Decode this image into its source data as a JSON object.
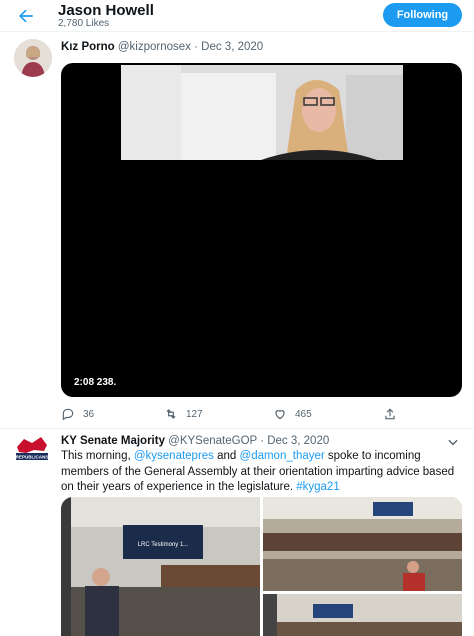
{
  "header": {
    "back_icon": "arrow-left-icon",
    "title": "Jason Howell",
    "subtitle": "2,780 Likes",
    "follow_label": "Following",
    "accent": "#1d9bf0"
  },
  "tweets": [
    {
      "name": "Kız Porno",
      "handle": "@kizpornosex",
      "date": "· Dec 3, 2020",
      "video_time": "2:08  238.",
      "replies": "36",
      "retweets": "127",
      "likes": "465"
    },
    {
      "name": "KY Senate Majority",
      "handle": "@KYSenateGOP",
      "date": "· Dec 3, 2020",
      "text_1": "This morning, ",
      "mention_1": "@kysenatepres",
      "text_2": " and ",
      "mention_2": "@damon_thayer",
      "text_3": " spoke to incoming members of the General Assembly at their orientation imparting advice based on their years of experience in the legislature. ",
      "hashtag": "#kyga21",
      "avatar_label": "REPUBLICANS",
      "media_1_screen": "LRC Testimony 1..."
    }
  ]
}
